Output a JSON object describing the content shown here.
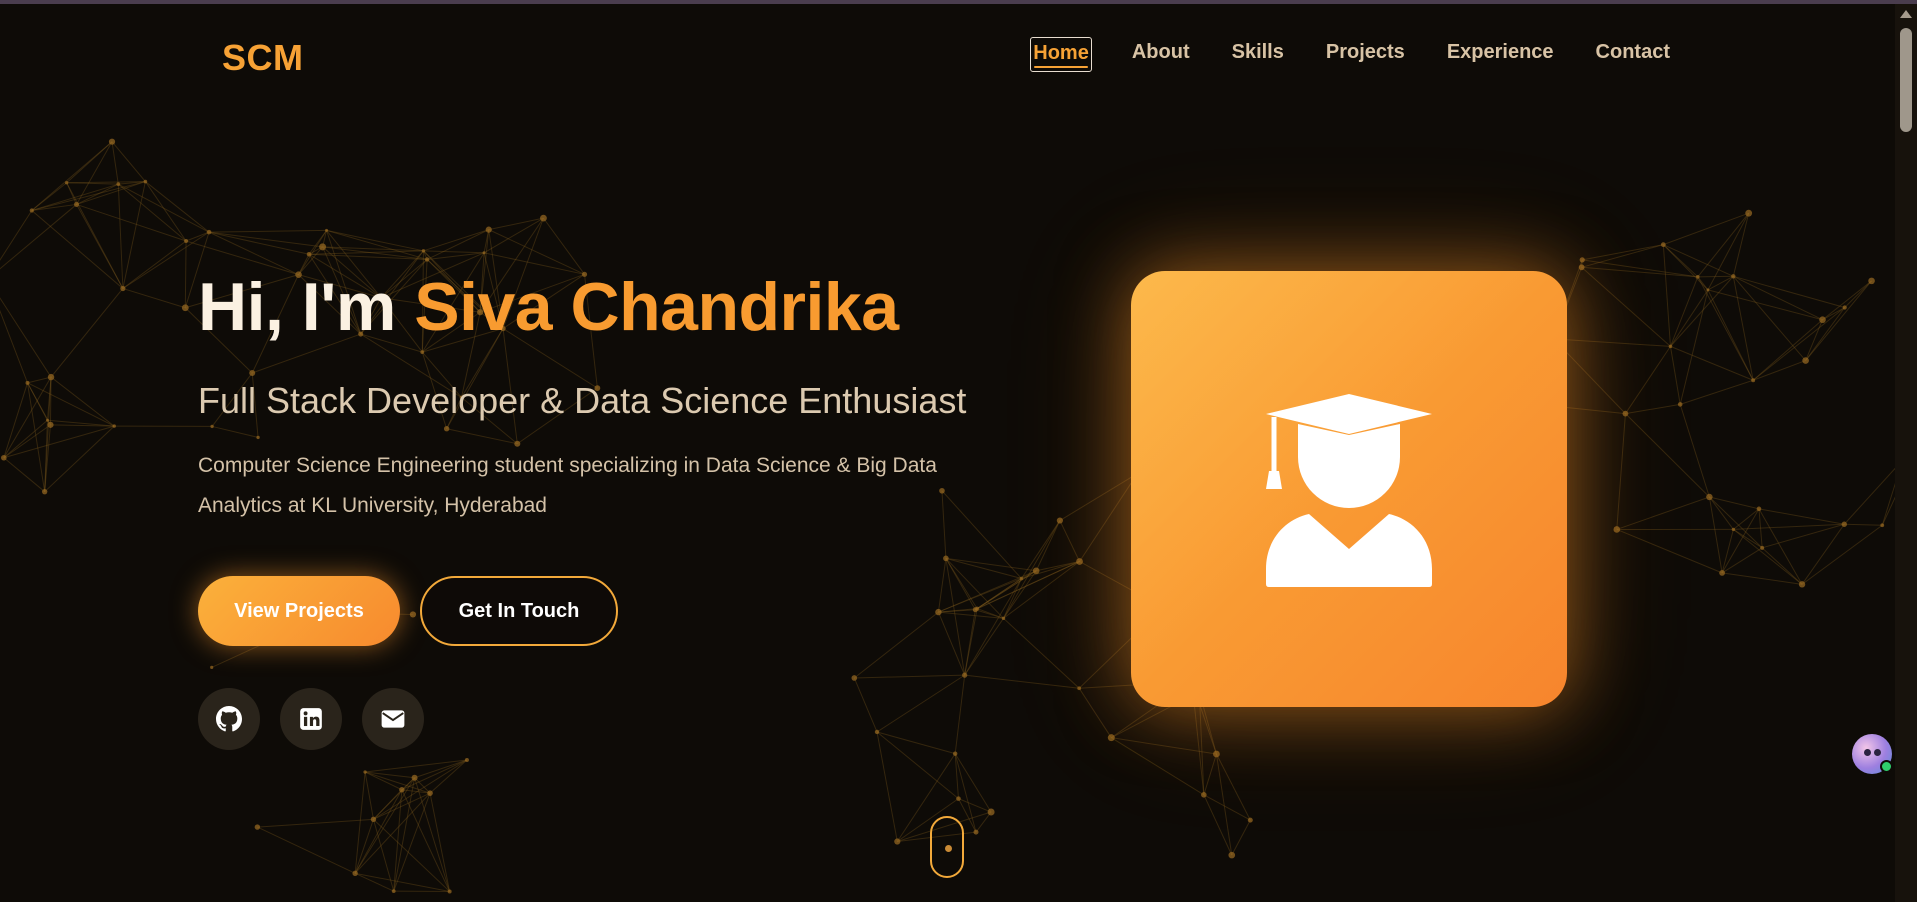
{
  "brand": {
    "logo_text": "SCM",
    "accent_color": "#f89b30"
  },
  "nav": {
    "items": [
      {
        "label": "Home",
        "active": true
      },
      {
        "label": "About",
        "active": false
      },
      {
        "label": "Skills",
        "active": false
      },
      {
        "label": "Projects",
        "active": false
      },
      {
        "label": "Experience",
        "active": false
      },
      {
        "label": "Contact",
        "active": false
      }
    ]
  },
  "hero": {
    "greeting": "Hi, I'm",
    "name": "Siva Chandrika",
    "subtitle": "Full Stack Developer & Data Science Enthusiast",
    "description": "Computer Science Engineering student specializing in Data Science & Big Data Analytics at KL University, Hyderabad",
    "primary_button": "View Projects",
    "secondary_button": "Get In Touch"
  },
  "socials": [
    {
      "icon": "github-icon"
    },
    {
      "icon": "linkedin-icon"
    },
    {
      "icon": "envelope-icon"
    }
  ],
  "avatar_card": {
    "icon": "graduation-cap-user-icon"
  }
}
